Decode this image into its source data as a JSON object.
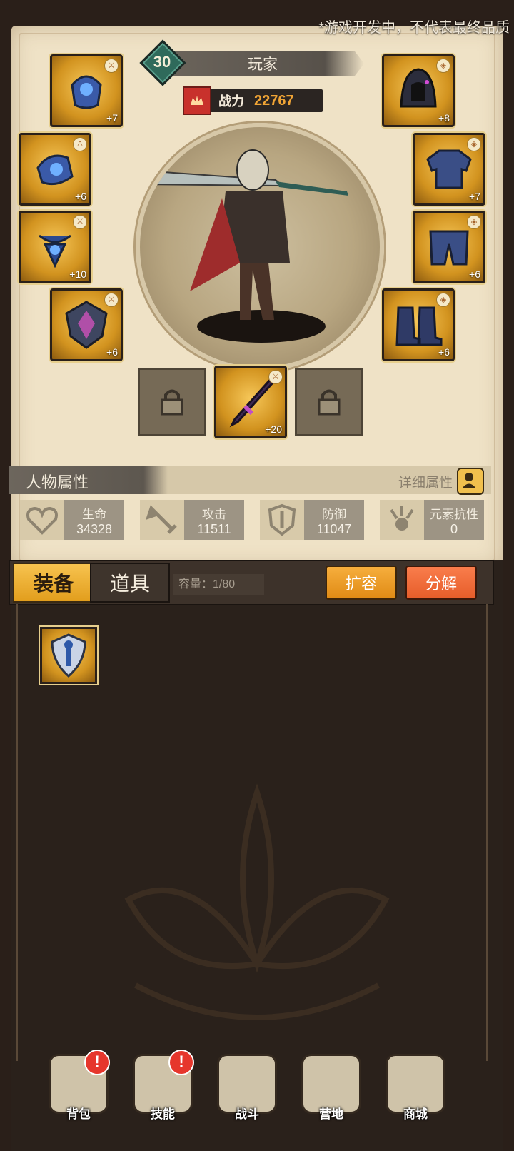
{
  "watermark": "*游戏开发中，不代表最终品质",
  "player": {
    "level": "30",
    "name": "玩家",
    "power_label": "战力",
    "power_value": "22767"
  },
  "equipment_left": [
    {
      "slot": "helmet",
      "plus": "+7"
    },
    {
      "slot": "gauntlet",
      "plus": "+6"
    },
    {
      "slot": "amulet",
      "plus": "+10"
    },
    {
      "slot": "shield",
      "plus": "+6"
    }
  ],
  "equipment_right": [
    {
      "slot": "hood",
      "plus": "+8"
    },
    {
      "slot": "chest",
      "plus": "+7"
    },
    {
      "slot": "pants",
      "plus": "+6"
    },
    {
      "slot": "boots",
      "plus": "+6"
    }
  ],
  "weapon": {
    "plus": "+20"
  },
  "attributes": {
    "title": "人物属性",
    "detail": "详细属性",
    "stats": [
      {
        "label": "生命",
        "value": "34328",
        "icon": "heart-icon"
      },
      {
        "label": "攻击",
        "value": "11511",
        "icon": "sword-icon"
      },
      {
        "label": "防御",
        "value": "11047",
        "icon": "shield-icon"
      },
      {
        "label": "元素抗性",
        "value": "0",
        "icon": "element-icon"
      }
    ]
  },
  "inventory": {
    "tabs": [
      "装备",
      "道具"
    ],
    "capacity": "容量：1/80",
    "expand": "扩容",
    "split": "分解"
  },
  "nav": [
    {
      "label": "背包",
      "alert": "!"
    },
    {
      "label": "技能",
      "alert": "!"
    },
    {
      "label": "战斗"
    },
    {
      "label": "营地"
    },
    {
      "label": "商城"
    }
  ]
}
